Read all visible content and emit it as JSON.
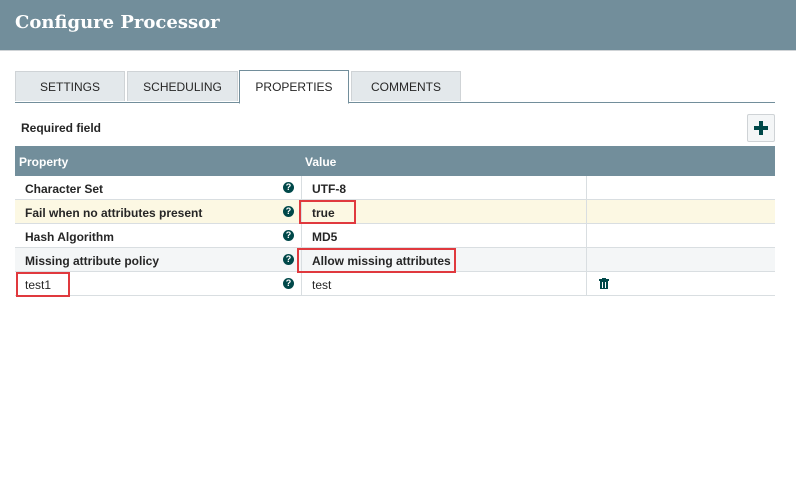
{
  "dialog": {
    "title": "Configure Processor"
  },
  "tabs": [
    {
      "label": "SETTINGS",
      "active": false
    },
    {
      "label": "SCHEDULING",
      "active": false
    },
    {
      "label": "PROPERTIES",
      "active": true
    },
    {
      "label": "COMMENTS",
      "active": false
    }
  ],
  "properties_panel": {
    "required_label": "Required field",
    "add_button_icon": "plus-icon"
  },
  "grid": {
    "columns": [
      "Property",
      "Value"
    ],
    "rows": [
      {
        "property": "Character Set",
        "value": "UTF-8",
        "help_icon": "question-icon"
      },
      {
        "property": "Fail when no attributes present",
        "value": "true",
        "help_icon": "question-icon"
      },
      {
        "property": "Hash Algorithm",
        "value": "MD5",
        "help_icon": "question-icon"
      },
      {
        "property": "Missing attribute policy",
        "value": "Allow missing attributes",
        "help_icon": "question-icon"
      },
      {
        "property": "test1",
        "value": "test",
        "help_icon": "question-icon",
        "delete_icon": "trash-icon"
      }
    ]
  },
  "colors": {
    "header_bg": "#728e9b",
    "help_icon": "#004849",
    "highlight_row": "#fcf8e3",
    "annotation_red": "#e0393e"
  }
}
